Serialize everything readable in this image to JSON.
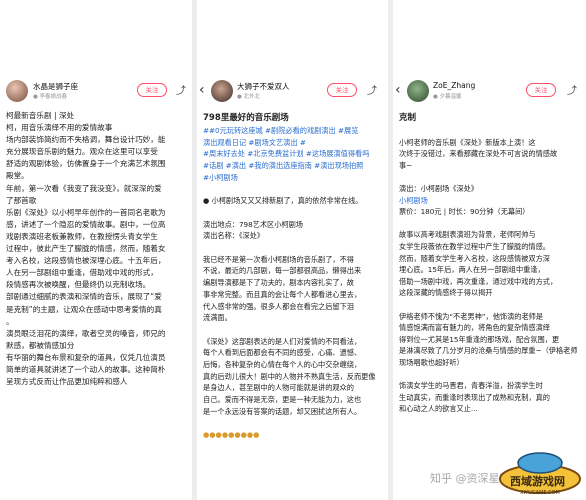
{
  "panels": [
    {
      "user": {
        "name": "水晶是狮子座",
        "sub": "● 李春娘战春"
      },
      "follow_label": "关注",
      "lines": [
        "柯最新音乐剧 | 深处",
        "柯，用音乐演绎不用的爱情故事",
        "场内部装饰简约而不失格调，舞台设计巧妙，能",
        "充分展现音乐剧的魅力。观众在这里可以享受",
        "舒适的观剧体验，仿佛置身于一个充满艺术氛围",
        "殿堂。",
        "年前，第一次看《我变了我没变》，就深深的爱",
        "了那首歌",
        "乐剧《深处》以小柯早年创作的一首同名老歌为",
        "感，讲述了一个隐忍的爱情故事。剧中，一位高",
        "戏剧表演班老板兼教师，在教授愣头青女学生",
        "过程中，彼此产生了朦胧的情感，然而，随着女",
        "考入名校，这段感情也被深埋心底。十五年后，",
        "人在另一部剧组中重逢，借助戏中戏的形式，",
        "段情感再次被唤醒，但最终仍以克制收场。",
        "部剧通过细腻的表演和深情的音乐，展现了“爱",
        "是克制”的主题，让观众在感动中思考爱情的真",
        "。",
        "演员眼泛泪花的演绎，歌者空灵的嗓音，师兄的",
        "默感，都被情感加分",
        "有华丽的舞台布景和复杂的道具，仅凭几位演员",
        "简单的道具就讲述了一个动人的故事。这种简朴",
        "呈现方式反而让作品更加纯粹和感人"
      ]
    },
    {
      "user": {
        "name": "大狮子不爱双人",
        "sub": "● 北外北"
      },
      "follow_label": "关注",
      "lines": [
        "798里最好的音乐剧场",
        "##0元玩转这座城 #剧院必看的戏剧演出 #展览",
        "演出观看日记 #剧场文艺演出 #",
        "#周末好去处 #北京免费盆计划 #这场展演值得看吗",
        "#话剧 #演出 #我的演出选座指南 #演出现场拍照",
        "#小柯剧场",
        "",
        "● 小柯剧场又又又排新剧了，真的依然非常在线。",
        "",
        "演出地点：798艺术区小柯剧场",
        "演出名称：《深处》",
        "",
        "我已经不是第一次看小柯剧场的音乐剧了，不得",
        "不说，最近的几部剧，每一部都很高品，懒得出来",
        "编剧导演都是下了功夫的，剧本内容扎实了，故",
        "事非常完整。而且真的会让每个人都看进心里去，",
        "代入感非常的强。很多人都会在看完之后留下泪",
        "流满面。",
        "",
        "《深处》这部剧表达的是人们对爱情的不同看法，",
        "每个人看到后面都会有不同的感受，心痛、遗憾、",
        "后悔，各种复杂的心情在每个人的心中交杂缠绕，",
        "真的后劲儿很大！剧中的人物并不熟真生活，反而更像",
        "是身边人，甚至剧中的人物可能就是讲的观众的",
        "自己。爱而不得是无奈，更是一种无能为力，这也",
        "是一个永远没有答案的话题，却又困扰这所有人。",
        "",
        "●●●●●●●●●"
      ]
    },
    {
      "user": {
        "name": "ZoE_Zhang",
        "sub": "● 夕暮温馨"
      },
      "follow_label": "关注",
      "lines": [
        "克制",
        "",
        "小柯老师的音乐剧《深处》新版本上演！这",
        "次终于没错过，来看那藏在深处不可言说的情感故",
        "事~",
        "",
        "演出：小柯剧场《深处》",
        "小柯剧场",
        "票价：180元 | 时长：90分钟（无幕间）",
        "",
        "故事以高考戏剧表演班为背景，老师阿帅与",
        "女学生段薇依在教学过程中产生了朦胧的情感。",
        "然而，随着女学生考入名校，这段感情被双方深",
        "埋心底。15年后，两人在另一部剧组中重逢，",
        "借助一场剧中戏，再次重逢，通过戏中戏的方式，",
        "这段深藏的情感终于得以揭开",
        "",
        "伊格老师不愧为“不老男神”，他饰演的老师是",
        "情感饱满而富有魅力的，将角色的复杂情感演绎",
        "得到位一尤其是15年重逢的那场戏，配合氛围，更",
        "是淋漓尽致了几分岁月的沧桑与情感的厚重~（伊格老师",
        "现场唱歌也超好听）",
        "",
        "饰演女学生的马晋君，青春洋溢，扮演学生时",
        "生动真实，而重逢时表现出了成熟和克制，真的",
        "和心动之人的欲言又止..."
      ]
    }
  ],
  "panel2_title": "798里最好的音乐剧场",
  "watermark": "知乎 @资深星玩家",
  "logo": {
    "text": "西域游戏网",
    "sub": "XIYUGAME.COM"
  }
}
